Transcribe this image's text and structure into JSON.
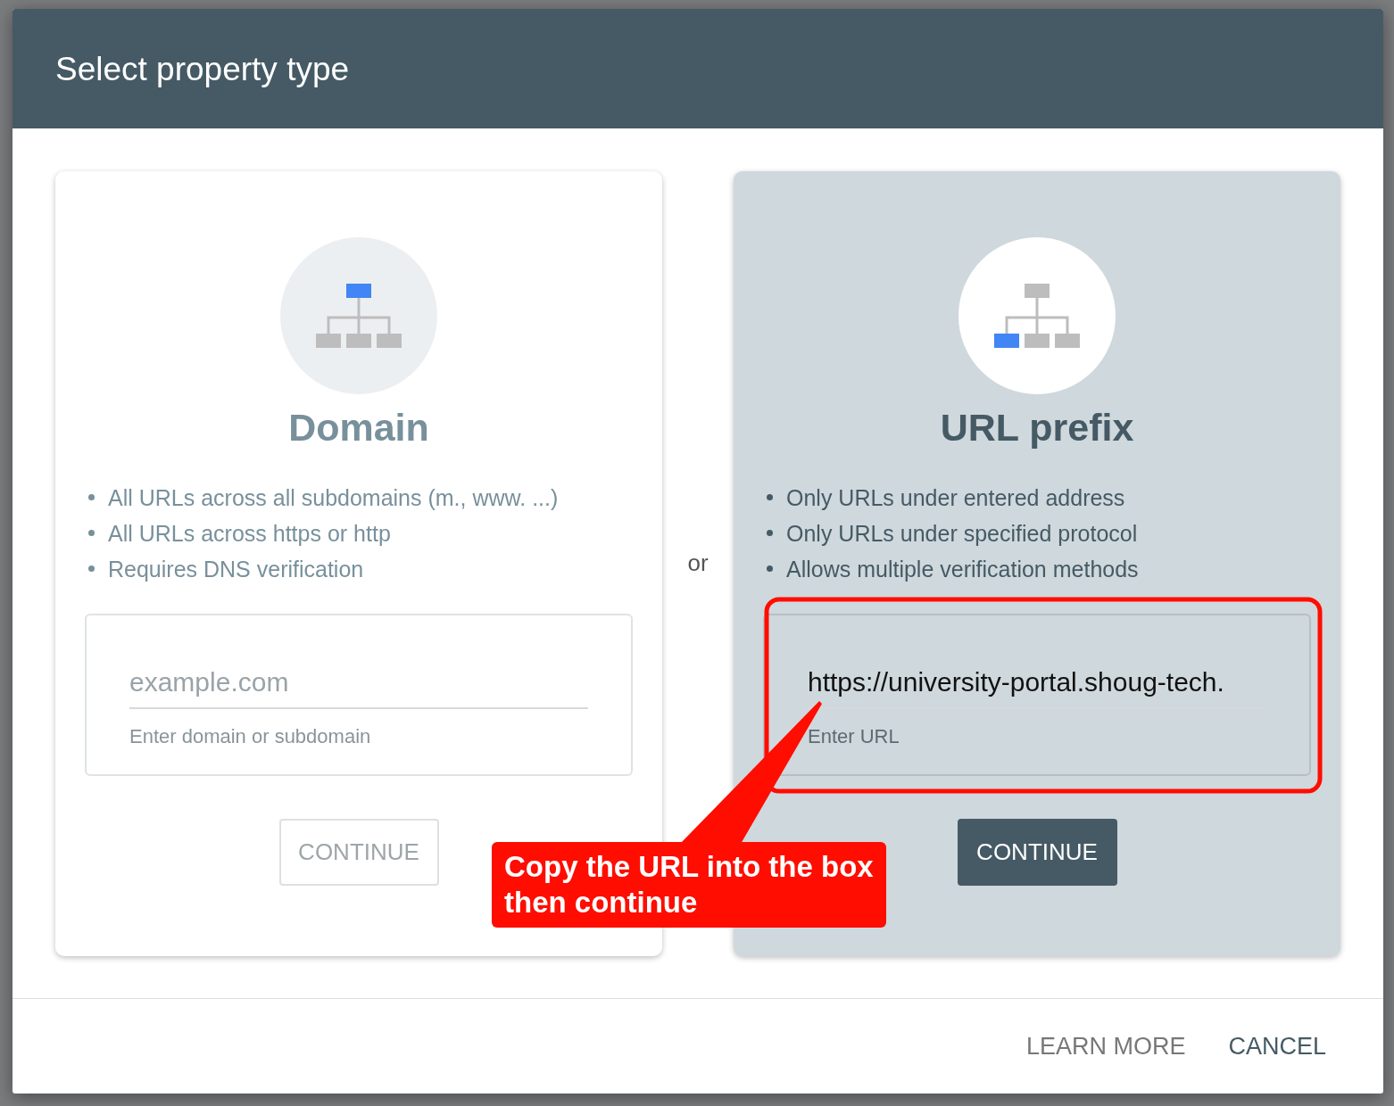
{
  "dialog": {
    "title": "Select property type",
    "cards": [
      {
        "kind": "domain",
        "selected": false,
        "title": "Domain",
        "bullets": [
          "All URLs across all subdomains (m., www. ...)",
          "All URLs across https or http",
          "Requires DNS verification"
        ],
        "field": {
          "placeholder": "example.com",
          "helper": "Enter domain or subdomain"
        },
        "button": {
          "label": "CONTINUE",
          "disabled": true
        }
      },
      {
        "kind": "url_prefix",
        "selected": true,
        "title": "URL prefix",
        "bullets": [
          "Only URLs under entered address",
          "Only URLs under specified protocol",
          "Allows multiple verification methods"
        ],
        "field": {
          "value": "https://university-portal.shoug-tech.",
          "helper": "Enter URL"
        },
        "button": {
          "label": "CONTINUE",
          "disabled": false
        }
      }
    ],
    "separator": "or",
    "footer_buttons": [
      "LEARN MORE",
      "CANCEL"
    ]
  },
  "annotation": {
    "text": "Copy the URL into the box then continue"
  }
}
